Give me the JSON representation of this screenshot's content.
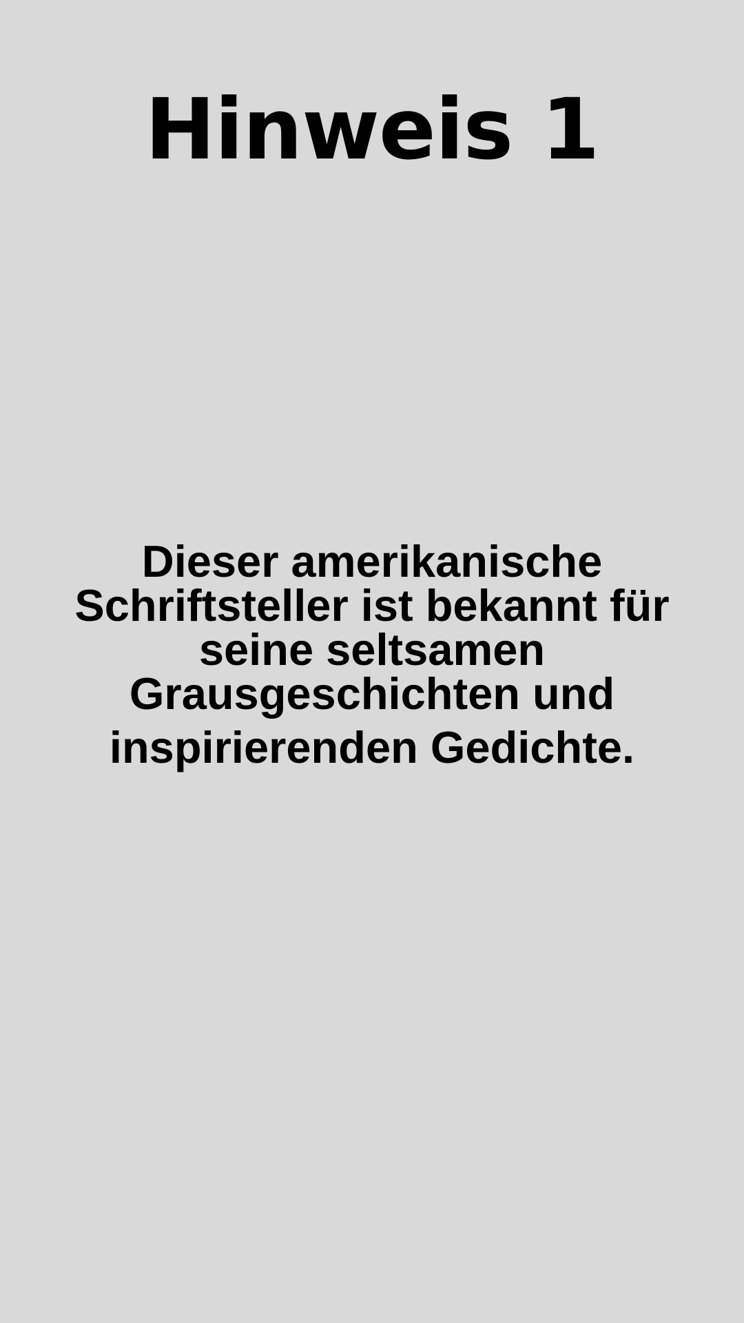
{
  "card": {
    "title": "Hinweis 1",
    "text_lines": [
      "Dieser amerikanische",
      "Schriftsteller ist bekannt für",
      "seine seltsamen",
      "Grausgeschichten und",
      "inspirierenden Gedichte."
    ]
  },
  "colors": {
    "background": "#d9d9d9",
    "text": "#000000"
  }
}
